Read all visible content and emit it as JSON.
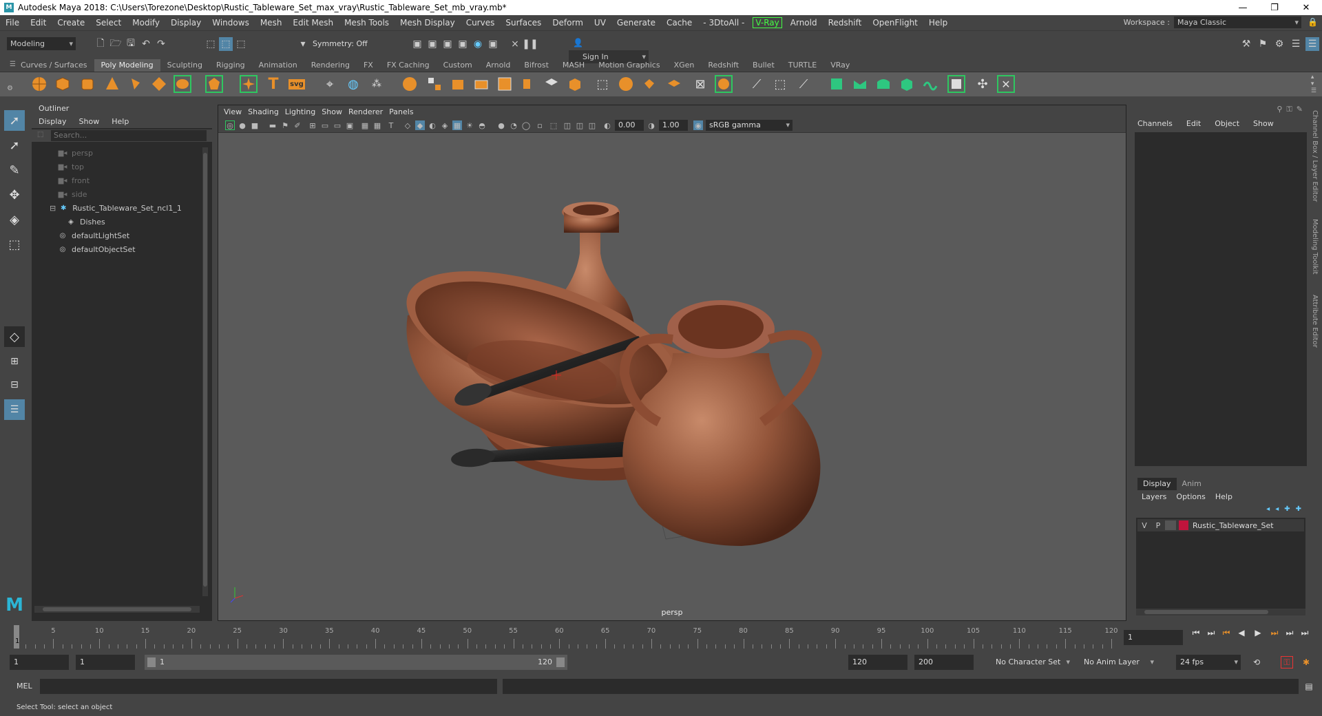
{
  "window": {
    "title": "Autodesk Maya 2018: C:\\Users\\Torezone\\Desktop\\Rustic_Tableware_Set_max_vray\\Rustic_Tableware_Set_mb_vray.mb*",
    "logo": "M"
  },
  "menus": [
    "File",
    "Edit",
    "Create",
    "Select",
    "Modify",
    "Display",
    "Windows",
    "Mesh",
    "Edit Mesh",
    "Mesh Tools",
    "Mesh Display",
    "Curves",
    "Surfaces",
    "Deform",
    "UV",
    "Generate",
    "Cache",
    "- 3DtoAll -",
    "V-Ray",
    "Arnold",
    "Redshift",
    "OpenFlight",
    "Help"
  ],
  "workspace": {
    "label": "Workspace :",
    "value": "Maya Classic"
  },
  "statusline": {
    "mode": "Modeling",
    "symmetry": "Symmetry: Off",
    "sign_in": "Sign In"
  },
  "shelf_tabs": [
    "Curves / Surfaces",
    "Poly Modeling",
    "Sculpting",
    "Rigging",
    "Animation",
    "Rendering",
    "FX",
    "FX Caching",
    "Custom",
    "Arnold",
    "Bifrost",
    "MASH",
    "Motion Graphics",
    "XGen",
    "Redshift",
    "Bullet",
    "TURTLE",
    "VRay"
  ],
  "shelf_active": "Poly Modeling",
  "shelf_svg_label": "svg",
  "shelf_text_label": "T",
  "outliner": {
    "title": "Outliner",
    "menus": [
      "Display",
      "Show",
      "Help"
    ],
    "search_placeholder": "Search...",
    "items": [
      {
        "label": "persp",
        "icon": "camera-icon",
        "dim": true
      },
      {
        "label": "top",
        "icon": "camera-icon",
        "dim": true
      },
      {
        "label": "front",
        "icon": "camera-icon",
        "dim": true
      },
      {
        "label": "side",
        "icon": "camera-icon",
        "dim": true
      },
      {
        "label": "Rustic_Tableware_Set_ncl1_1",
        "icon": "group-icon",
        "dim": false
      },
      {
        "label": "Dishes",
        "icon": "mesh-icon",
        "dim": false
      },
      {
        "label": "defaultLightSet",
        "icon": "set-icon",
        "dim": false
      },
      {
        "label": "defaultObjectSet",
        "icon": "set-icon",
        "dim": false
      }
    ]
  },
  "viewport": {
    "menus": [
      "View",
      "Shading",
      "Lighting",
      "Show",
      "Renderer",
      "Panels"
    ],
    "exposure": "0.00",
    "gamma": "1.00",
    "colorspace": "sRGB gamma",
    "camera_label": "persp"
  },
  "channelbox": {
    "menus": [
      "Channels",
      "Edit",
      "Object",
      "Show"
    ]
  },
  "side_tabs": [
    "Channel Box / Layer Editor",
    "Modeling Toolkit",
    "Attribute Editor"
  ],
  "layers": {
    "tabs": [
      "Display",
      "Anim"
    ],
    "menus": [
      "Layers",
      "Options",
      "Help"
    ],
    "row": {
      "v": "V",
      "p": "P",
      "name": "Rustic_Tableware_Set",
      "color": "#c0143c"
    }
  },
  "timeline": {
    "ticks": [
      "5",
      "10",
      "15",
      "20",
      "25",
      "30",
      "35",
      "40",
      "45",
      "50",
      "55",
      "60",
      "65",
      "70",
      "75",
      "80",
      "85",
      "90",
      "95",
      "100",
      "105",
      "110",
      "115",
      "120"
    ],
    "current": "1",
    "current_field": "1"
  },
  "range": {
    "start": "1",
    "start2": "1",
    "slider_start": "1",
    "slider_end": "120",
    "end": "120",
    "end2": "200",
    "char_set": "No Character Set",
    "anim_layer": "No Anim Layer",
    "fps": "24 fps"
  },
  "cmdline": {
    "label": "MEL"
  },
  "helpline": "Select Tool: select an object"
}
